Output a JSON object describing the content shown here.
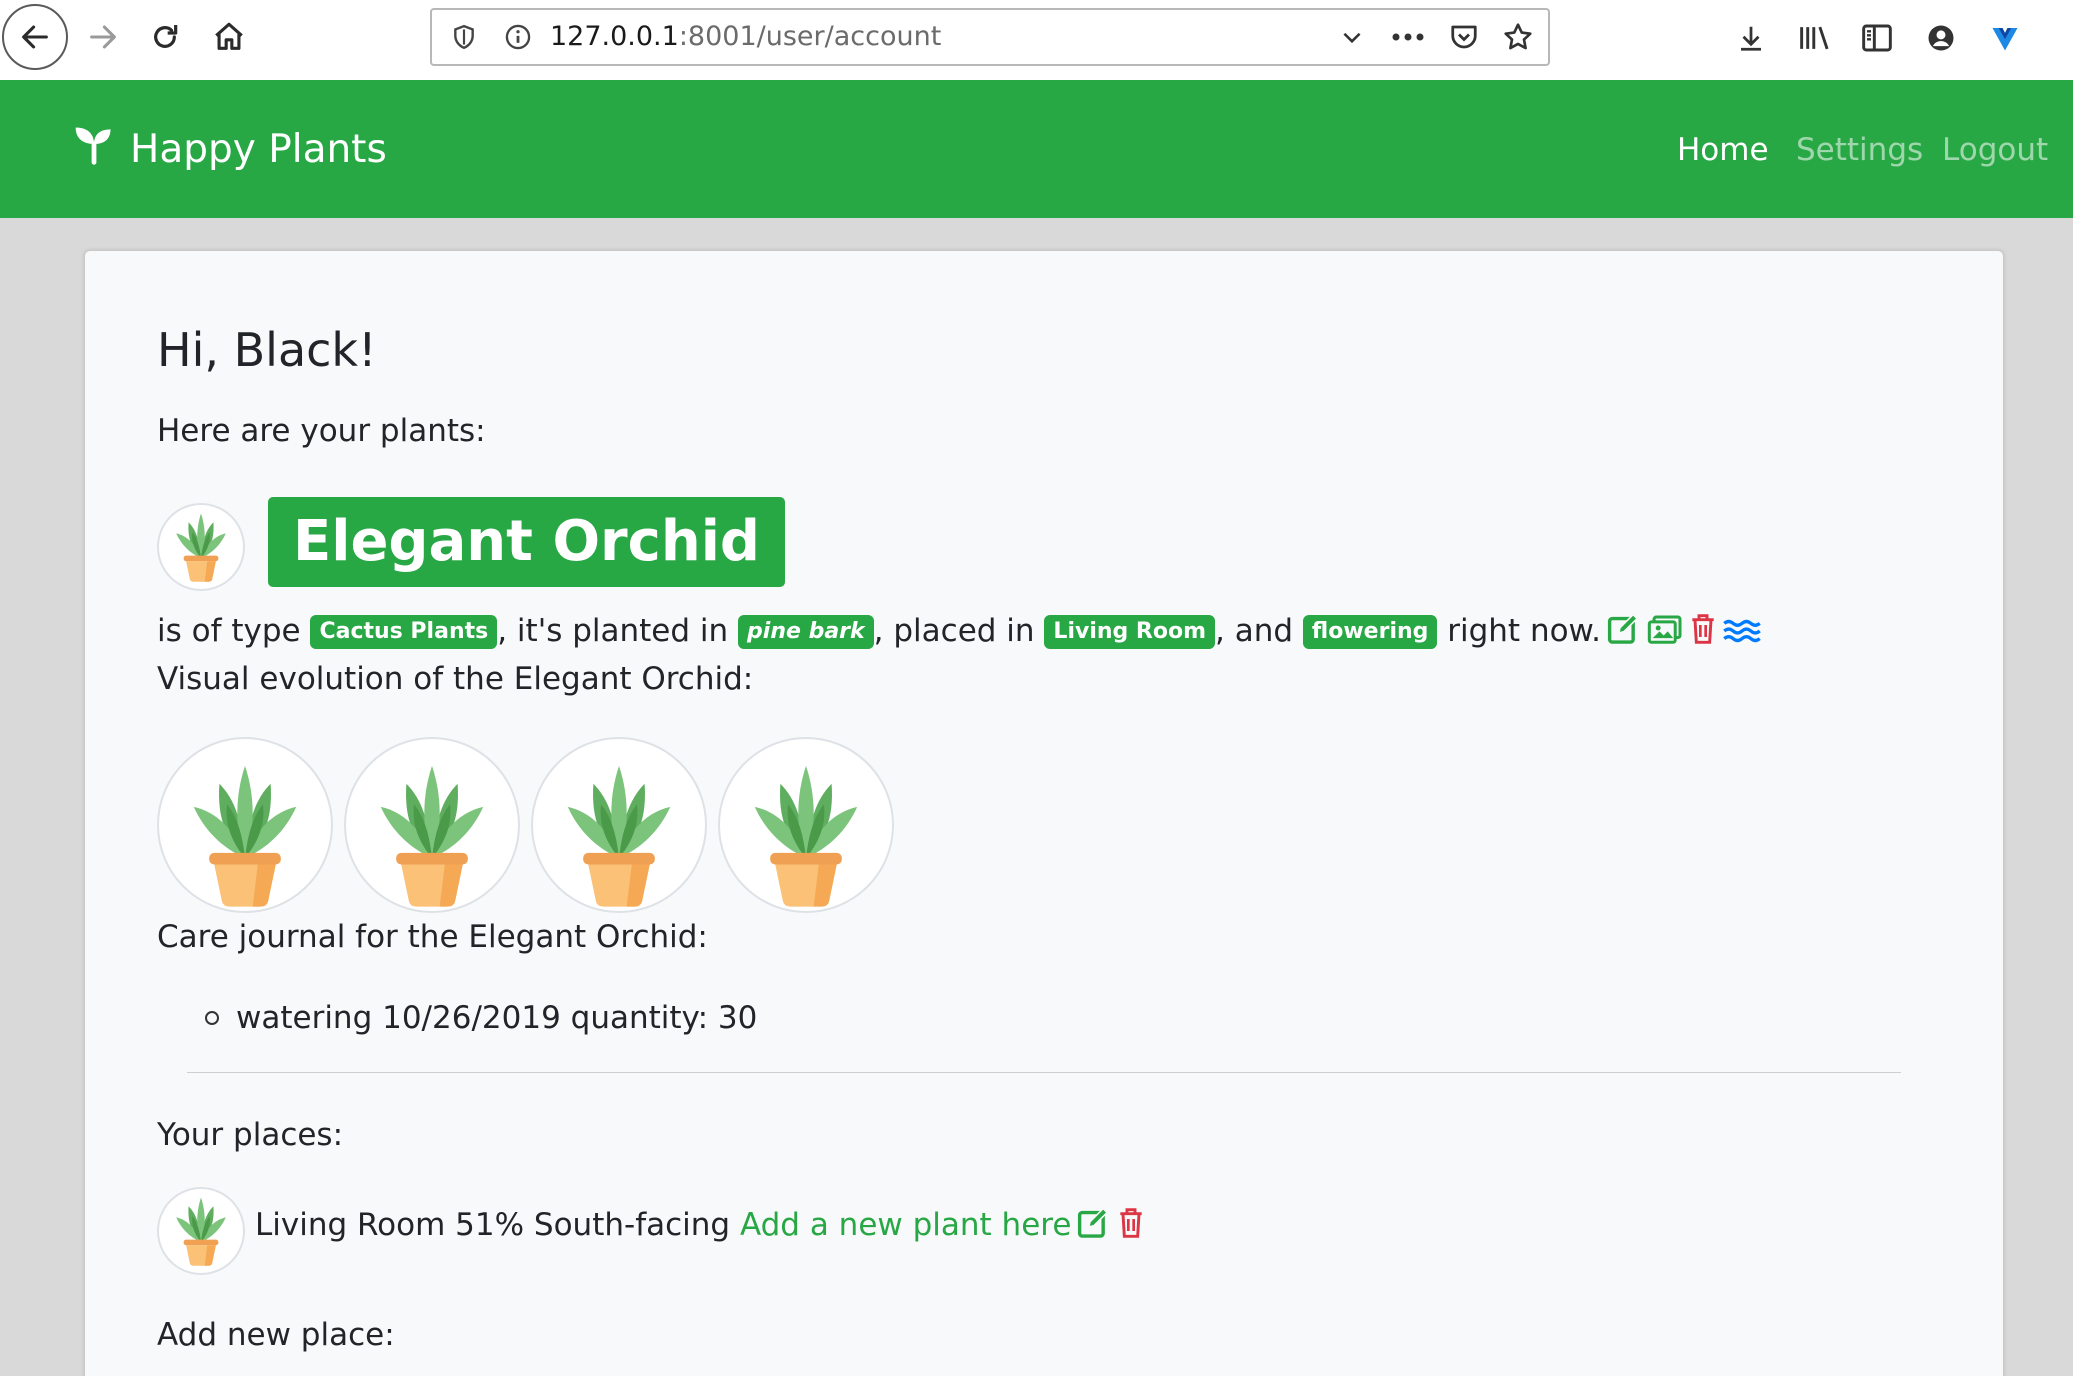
{
  "browser": {
    "url_host": "127.0.0.1",
    "url_rest": ":8001/user/account"
  },
  "navbar": {
    "brand": "Happy Plants",
    "links": [
      {
        "label": "Home",
        "active": true
      },
      {
        "label": "Settings",
        "active": false
      },
      {
        "label": "Logout",
        "active": false
      }
    ]
  },
  "main": {
    "greeting": "Hi, Black!",
    "plants_intro": "Here are your plants:",
    "plant": {
      "name": "Elegant Orchid",
      "sentence_part1": "is of type",
      "type": "Cactus Plants",
      "sentence_part2": ", it's planted in",
      "soil": "pine bark",
      "sentence_part3": ", placed in",
      "place": "Living Room",
      "sentence_part4": ", and",
      "state": "flowering",
      "sentence_part5": "right now.",
      "evolution_label": "Visual evolution of the Elegant Orchid:",
      "journal_label": "Care journal for the Elegant Orchid:",
      "journal": [
        "watering 10/26/2019 quantity: 30"
      ]
    },
    "places_label": "Your places:",
    "place_row": {
      "text": "Living Room 51% South-facing",
      "add_link": "Add a new plant here"
    },
    "add_place_label": "Add new place:"
  },
  "colors": {
    "primary": "#28a745",
    "danger": "#dc3545",
    "info": "#007bff"
  }
}
